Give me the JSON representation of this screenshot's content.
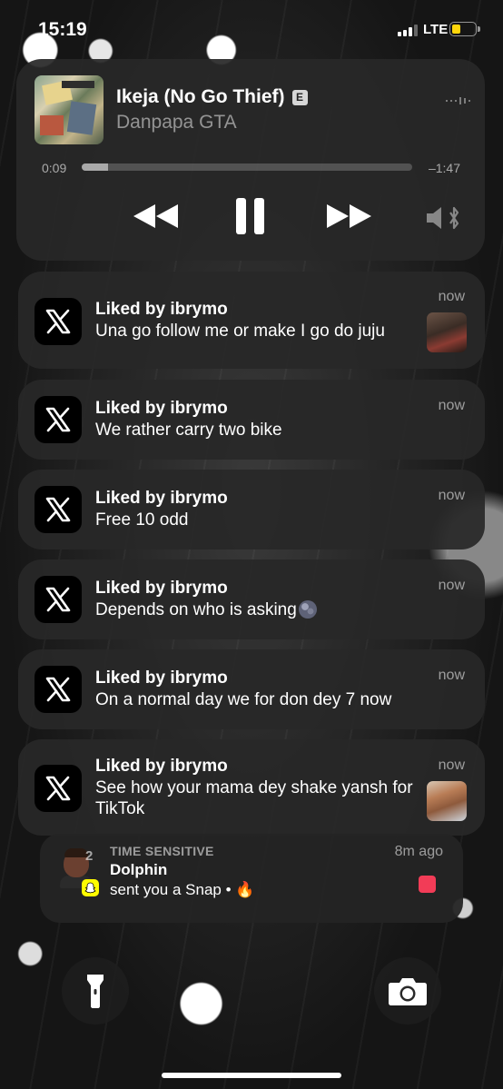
{
  "status_bar": {
    "time": "15:19",
    "network": "LTE",
    "signal_bars": 3,
    "signal_bars_total": 4,
    "battery_level": 0.25,
    "battery_color": "#ffd60a"
  },
  "media": {
    "title": "Ikeja (No Go Thief)",
    "explicit_badge": "E",
    "artist": "Danpapa GTA",
    "elapsed": "0:09",
    "remaining": "–1:47",
    "progress": 0.08,
    "controls": [
      "rewind-icon",
      "pause-icon",
      "fast-forward-icon",
      "speaker-bluetooth-icon"
    ]
  },
  "notifications": [
    {
      "app_icon": "x-logo-icon",
      "title": "Liked by ibrymo",
      "body": "Una go follow me or make I go do juju",
      "time": "now",
      "has_thumbnail": true
    },
    {
      "app_icon": "x-logo-icon",
      "title": "Liked by ibrymo",
      "body": "We rather carry two bike",
      "time": "now",
      "has_thumbnail": false
    },
    {
      "app_icon": "x-logo-icon",
      "title": "Liked by ibrymo",
      "body": "Free 10 odd",
      "time": "now",
      "has_thumbnail": false
    },
    {
      "app_icon": "x-logo-icon",
      "title": "Liked by ibrymo",
      "body": "Depends on who is asking",
      "emoji": "new-moon-face",
      "time": "now",
      "has_thumbnail": false
    },
    {
      "app_icon": "x-logo-icon",
      "title": "Liked by ibrymo",
      "body": "On a normal day we for don dey 7 now",
      "time": "now",
      "has_thumbnail": false
    },
    {
      "app_icon": "x-logo-icon",
      "title": "Liked by ibrymo",
      "body": "See how your mama dey shake yansh for TikTok",
      "time": "now",
      "has_thumbnail": true
    }
  ],
  "snap_notification": {
    "label": "TIME SENSITIVE",
    "time": "8m ago",
    "sender": "Dolphin",
    "message": "sent you a Snap • 🔥",
    "count": "2",
    "badge_color": "#fffc00",
    "snap_color": "#f23c57"
  },
  "bottom": {
    "left_button": "flashlight-icon",
    "right_button": "camera-icon"
  }
}
